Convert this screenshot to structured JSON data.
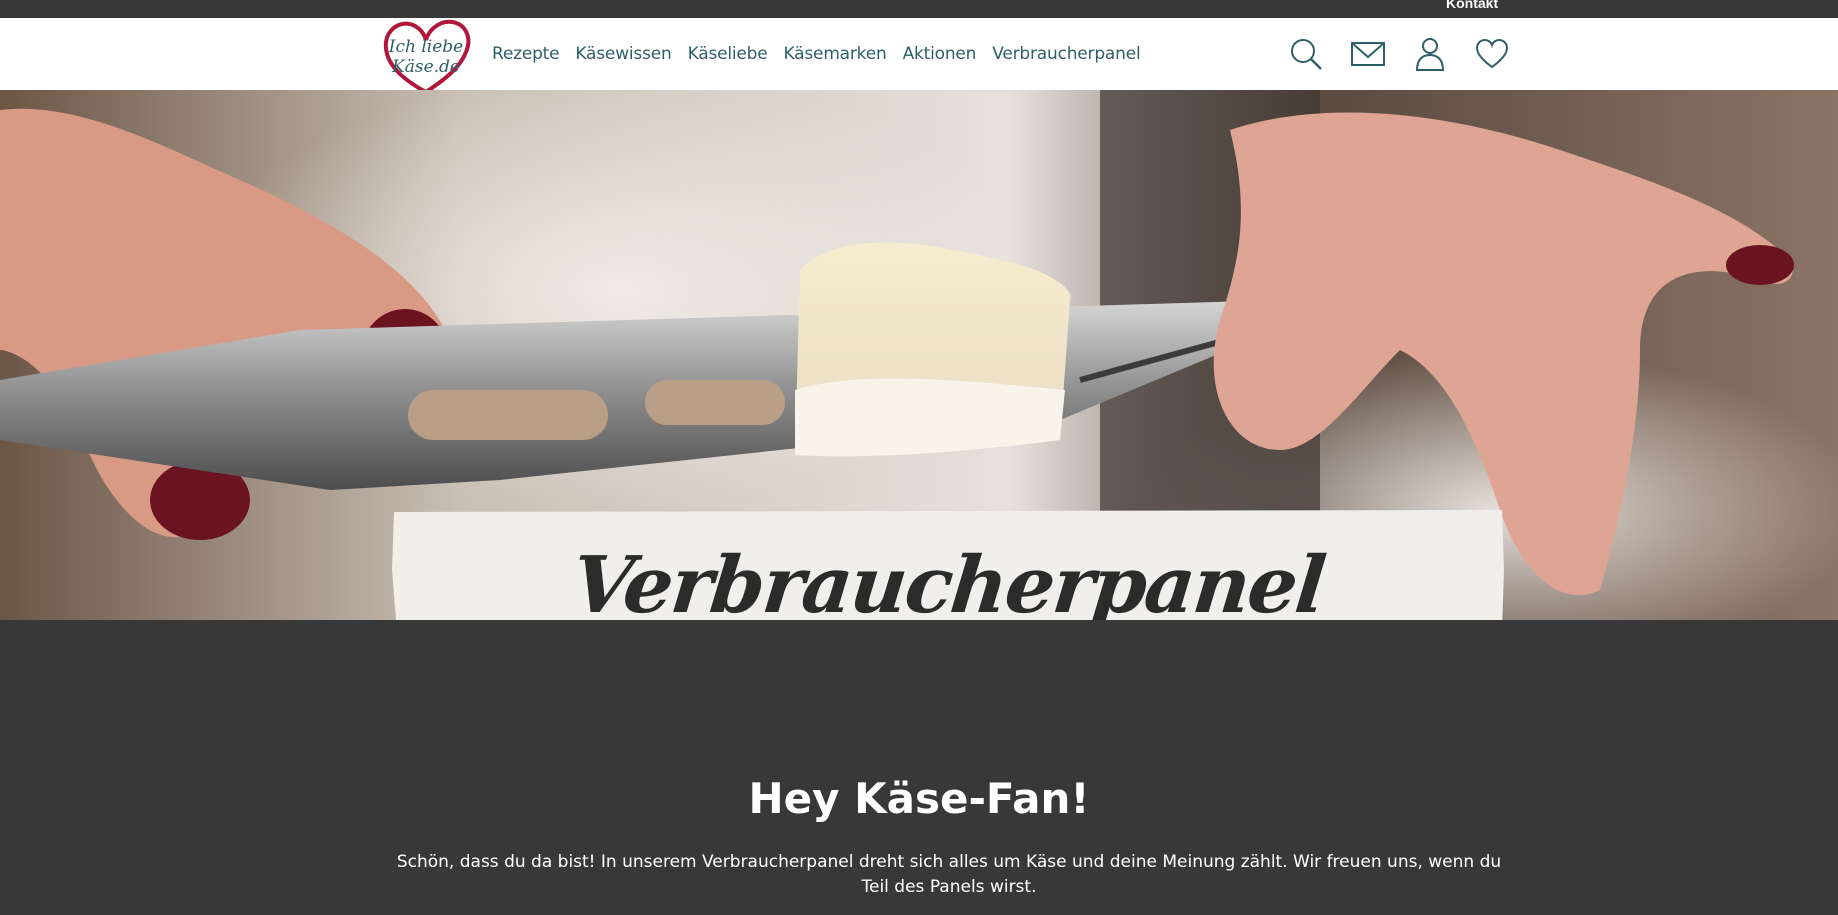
{
  "topbar": {
    "contact_label": "Kontakt"
  },
  "logo": {
    "line1": "Ich liebe",
    "line2": "Käse.de"
  },
  "nav": {
    "items": [
      {
        "label": "Rezepte"
      },
      {
        "label": "Käsewissen"
      },
      {
        "label": "Käseliebe"
      },
      {
        "label": "Käsemarken"
      },
      {
        "label": "Aktionen"
      },
      {
        "label": "Verbraucherpanel"
      }
    ]
  },
  "header_icons": [
    "search-icon",
    "mail-icon",
    "user-icon",
    "heart-icon"
  ],
  "hero": {
    "title": "Verbraucherpanel"
  },
  "content": {
    "heading": "Hey Käse-Fan!",
    "intro": "Schön, dass du da bist! In unserem Verbraucherpanel dreht sich alles um Käse und deine Meinung zählt. Wir freuen uns, wenn du Teil des Panels wirst."
  },
  "colors": {
    "brand_red": "#b0173b",
    "nav_text": "#2d5f6a",
    "dark_bg": "#383838"
  }
}
